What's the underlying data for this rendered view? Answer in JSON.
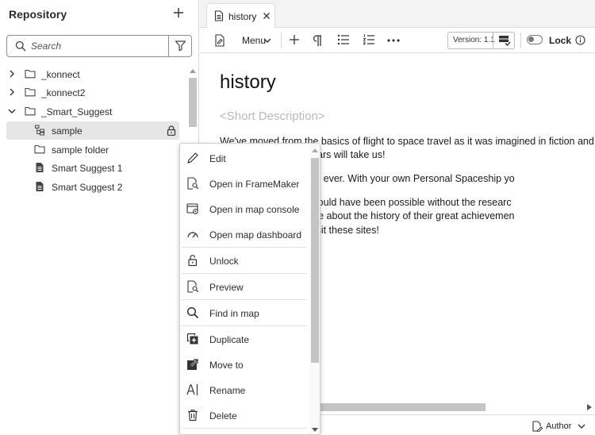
{
  "repository": {
    "title": "Repository",
    "search_placeholder": "Search",
    "tree": [
      {
        "label": "_konnect",
        "expanded": false
      },
      {
        "label": "_konnect2",
        "expanded": false
      },
      {
        "label": "_Smart_Suggest",
        "expanded": true
      },
      {
        "label": "sample",
        "selected": true,
        "locked": true
      },
      {
        "label": "sample folder"
      },
      {
        "label": "Smart Suggest 1"
      },
      {
        "label": "Smart Suggest 2"
      }
    ]
  },
  "tab": {
    "label": "history"
  },
  "toolbar": {
    "menu_label": "Menu",
    "version_label": "Version: 1.1",
    "lock_label": "Lock"
  },
  "editor": {
    "title": "history",
    "short_description": "<Short Description>",
    "paragraphs": [
      "We've moved from the basics of flight to space travel as it was imagined in fiction and seen",
      "where the next 100 years will take us!",
      "ace flight is closer than ever. With your own Personal Spaceship yo",
      "Personal Spaceship would have been possible without the researc",
      "at NASA. To learn more about the history of their great achievemen",
      "ture of NASA holds, visit these sites!"
    ]
  },
  "status": {
    "author_label": "Author"
  },
  "context_menu": {
    "items": [
      {
        "label": "Edit",
        "icon": "pencil-icon"
      },
      {
        "label": "Open in FrameMaker",
        "icon": "framemaker-icon"
      },
      {
        "label": "Open in map console",
        "icon": "map-console-icon"
      },
      {
        "label": "Open map dashboard",
        "icon": "dashboard-gauge-icon"
      },
      {
        "label": "Unlock",
        "icon": "unlock-icon"
      },
      {
        "label": "Preview",
        "icon": "preview-icon"
      },
      {
        "label": "Find in map",
        "icon": "magnifier-icon"
      },
      {
        "label": "Duplicate",
        "icon": "duplicate-icon"
      },
      {
        "label": "Move to",
        "icon": "move-to-icon"
      },
      {
        "label": "Rename",
        "icon": "rename-icon"
      },
      {
        "label": "Delete",
        "icon": "trash-icon"
      }
    ]
  }
}
